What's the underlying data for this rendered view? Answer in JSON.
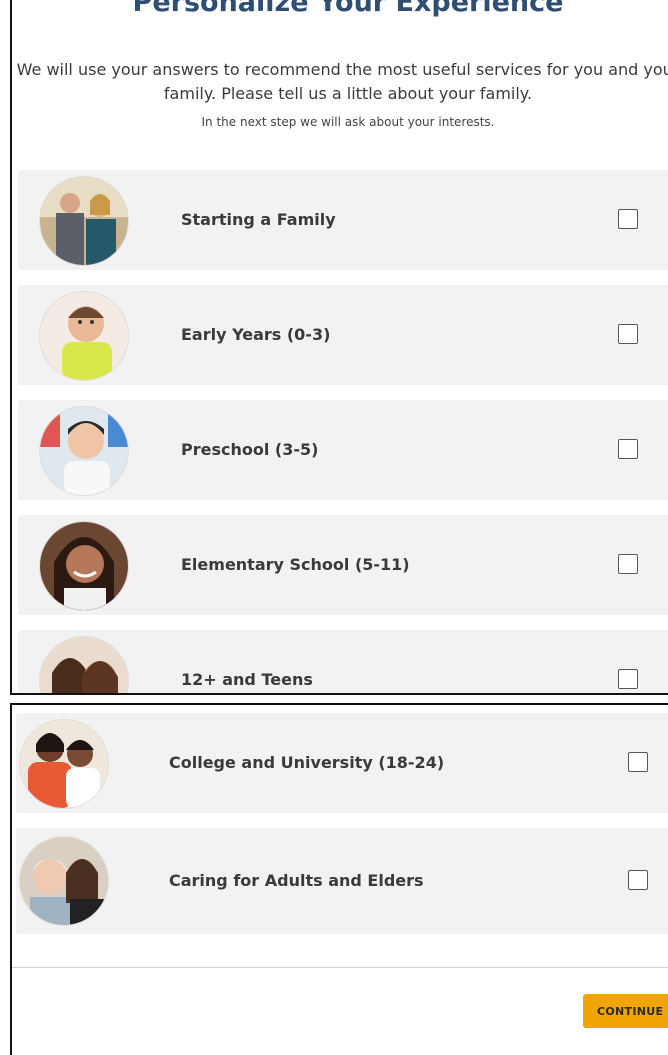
{
  "header": {
    "title": "Personalize Your Experience",
    "intro": "We will use your answers to recommend the most useful services for you and your family. Please tell us a little about your family.",
    "sub_intro": "In the next step we will ask about your interests."
  },
  "options": [
    {
      "label": "Starting a Family",
      "checked": false,
      "photo": "couple-photo"
    },
    {
      "label": "Early Years (0-3)",
      "checked": false,
      "photo": "baby-photo"
    },
    {
      "label": "Preschool (3-5)",
      "checked": false,
      "photo": "preschooler-photo"
    },
    {
      "label": "Elementary School (5-11)",
      "checked": false,
      "photo": "schoolgirl-photo"
    },
    {
      "label": "12+ and Teens",
      "checked": false,
      "photo": "teens-photo"
    },
    {
      "label": "College and University (18-24)",
      "checked": false,
      "photo": "students-photo"
    },
    {
      "label": "Caring for Adults and Elders",
      "checked": false,
      "photo": "elder-photo"
    }
  ],
  "footer": {
    "continue_label": "CONTINUE"
  },
  "colors": {
    "title": "#2e4e72",
    "card_bg": "#f2f2f2",
    "button": "#f0a500"
  }
}
